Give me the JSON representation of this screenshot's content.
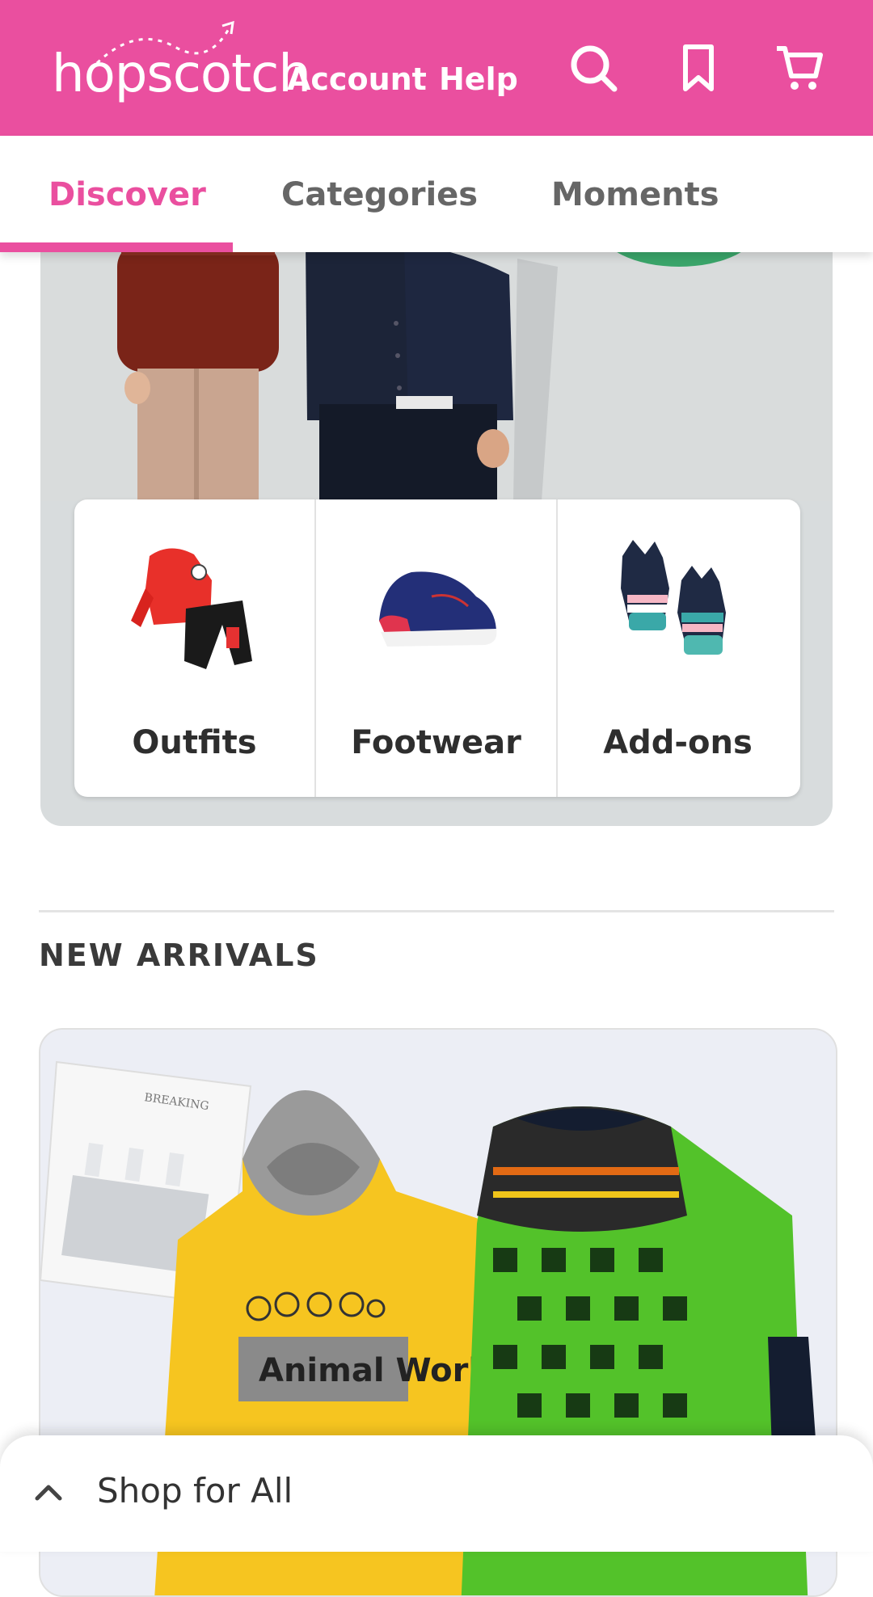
{
  "header": {
    "logo_text": "hopscotch",
    "nav": {
      "account": "Account",
      "help": "Help"
    },
    "icons": [
      "search-icon",
      "bookmark-icon",
      "cart-icon"
    ],
    "background": "#ea4f9f"
  },
  "tabs": [
    {
      "label": "Discover",
      "active": true
    },
    {
      "label": "Categories",
      "active": false
    },
    {
      "label": "Moments",
      "active": false
    }
  ],
  "hero": {
    "categories": [
      {
        "label": "Outfits"
      },
      {
        "label": "Footwear"
      },
      {
        "label": "Add-ons"
      }
    ]
  },
  "new_arrivals": {
    "title": "NEW ARRIVALS",
    "hoodie_print": "Animal World",
    "magazine_text": "BREAKING"
  },
  "bottom_sheet": {
    "label": "Shop for All"
  },
  "colors": {
    "accent": "#ea4f9f",
    "inactive_tab": "#666666"
  }
}
